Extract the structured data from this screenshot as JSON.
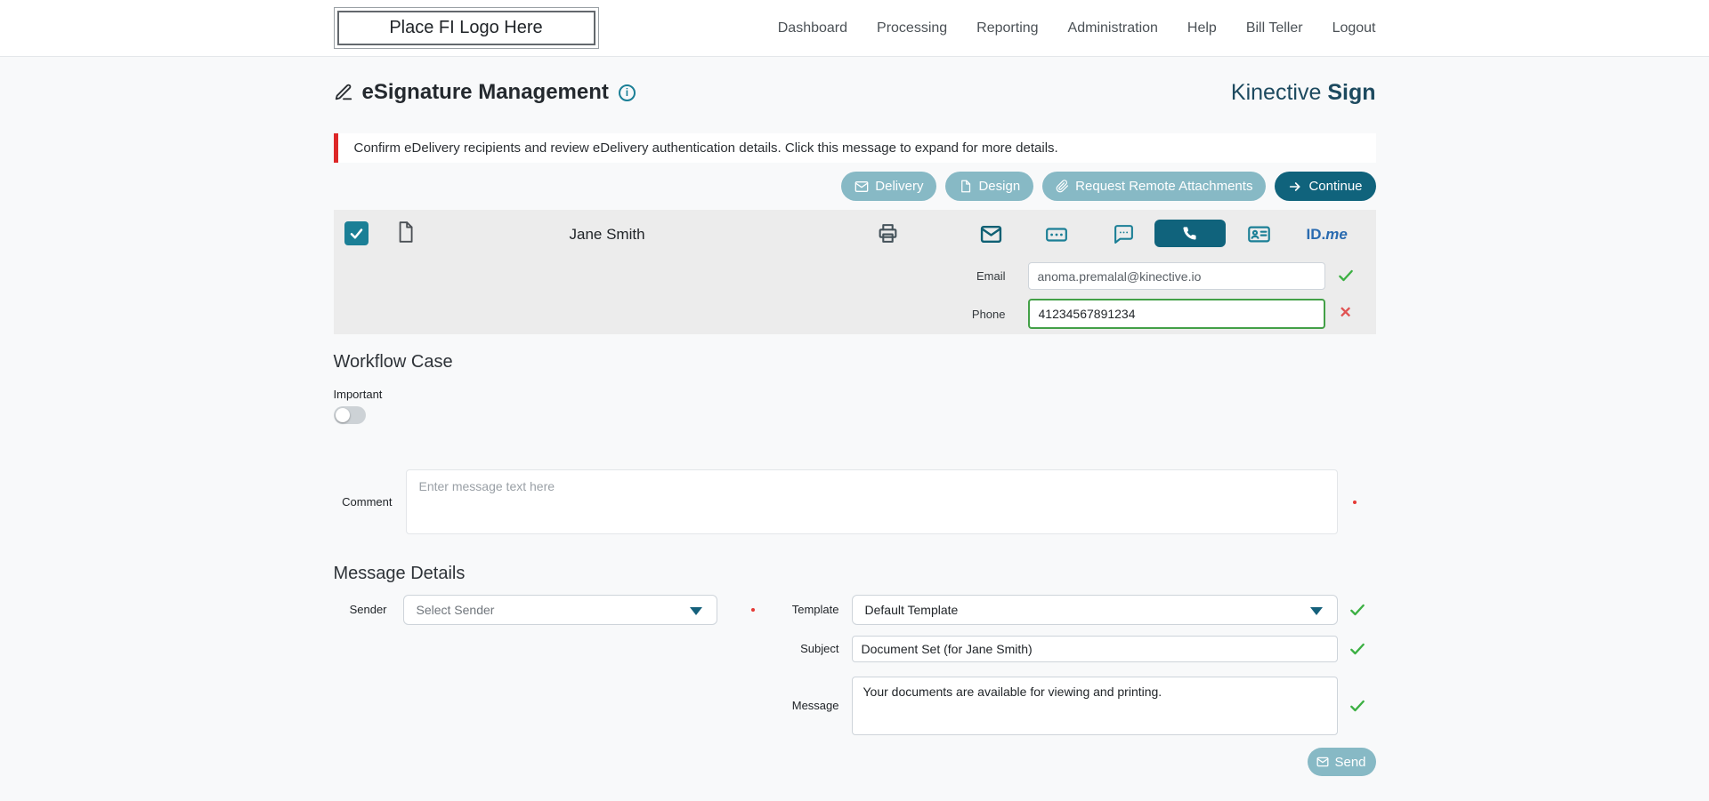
{
  "nav": {
    "logo": "Place FI Logo Here",
    "items": [
      {
        "label": "Dashboard"
      },
      {
        "label": "Processing"
      },
      {
        "label": "Reporting"
      },
      {
        "label": "Administration"
      },
      {
        "label": "Help"
      },
      {
        "label": "Bill Teller"
      },
      {
        "label": "Logout"
      }
    ]
  },
  "header": {
    "title": "eSignature Management",
    "brand": {
      "name": "Kinective",
      "product": "Sign"
    }
  },
  "alert": {
    "message": "Confirm eDelivery recipients and review eDelivery authentication details. Click this message to expand for more details."
  },
  "toolbar": {
    "delivery_label": "Delivery",
    "design_label": "Design",
    "request_remote_label": "Request Remote Attachments",
    "continue_label": "Continue"
  },
  "recipient": {
    "name": "Jane Smith",
    "idme_id": "ID.",
    "idme_me": "me",
    "email": {
      "label": "Email",
      "value": "anoma.premalal@kinective.io"
    },
    "phone": {
      "label": "Phone",
      "value": "41234567891234"
    }
  },
  "workflow": {
    "heading": "Workflow Case",
    "important_label": "Important",
    "comment": {
      "label": "Comment",
      "placeholder": "Enter message text here"
    }
  },
  "message_details": {
    "heading": "Message Details",
    "sender": {
      "label": "Sender",
      "value": "Select Sender"
    },
    "template": {
      "label": "Template",
      "value": "Default Template"
    },
    "subject": {
      "label": "Subject",
      "value": "Document Set (for Jane Smith)"
    },
    "message": {
      "label": "Message",
      "value": "Your documents are available for viewing and printing."
    },
    "send_label": "Send"
  },
  "colors": {
    "accent_teal_dark": "#10637c",
    "accent_teal_light": "#87b9c5",
    "icon_teal": "#1b7f96",
    "success_green": "#3cb043",
    "error_red": "#e05252",
    "alert_red": "#dd2727",
    "brand_navy": "#1d4a5f",
    "idme_blue": "#2a6bb0"
  }
}
